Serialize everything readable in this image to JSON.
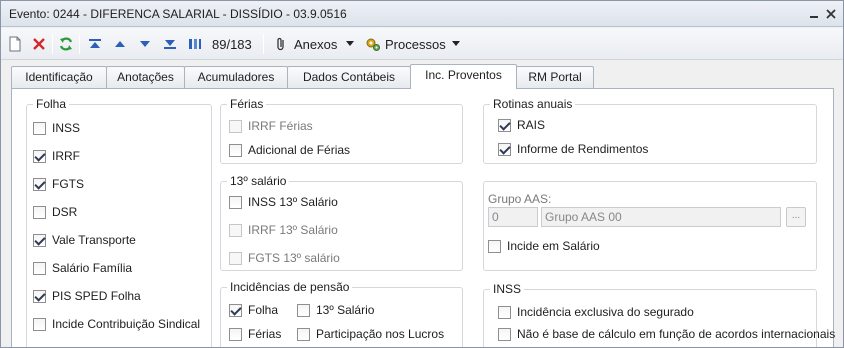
{
  "window": {
    "title": "Evento: 0244 - DIFERENCA SALARIAL - DISSÍDIO - 03.9.0516"
  },
  "toolbar": {
    "record_position": "89/183",
    "anexos_label": "Anexos",
    "processos_label": "Processos"
  },
  "tabs": [
    {
      "label": "Identificação"
    },
    {
      "label": "Anotações"
    },
    {
      "label": "Acumuladores"
    },
    {
      "label": "Dados Contábeis"
    },
    {
      "label": "Inc. Proventos"
    },
    {
      "label": "RM Portal"
    }
  ],
  "active_tab": "Inc. Proventos",
  "folha": {
    "title": "Folha",
    "items": [
      {
        "label": "INSS",
        "checked": false
      },
      {
        "label": "IRRF",
        "checked": true
      },
      {
        "label": "FGTS",
        "checked": true
      },
      {
        "label": "DSR",
        "checked": false
      },
      {
        "label": "Vale Transporte",
        "checked": true
      },
      {
        "label": "Salário Família",
        "checked": false
      },
      {
        "label": "PIS SPED Folha",
        "checked": true
      },
      {
        "label": "Incide Contribuição Sindical",
        "checked": false
      }
    ]
  },
  "ferias": {
    "title": "Férias",
    "items": [
      {
        "label": "IRRF Férias",
        "checked": false,
        "disabled": true
      },
      {
        "label": "Adicional de Férias",
        "checked": false,
        "disabled": false
      }
    ]
  },
  "decimo": {
    "title": "13º salário",
    "items": [
      {
        "label": "INSS 13º Salário",
        "checked": false,
        "disabled": false
      },
      {
        "label": "IRRF 13º Salário",
        "checked": false,
        "disabled": true
      },
      {
        "label": "FGTS 13º salário",
        "checked": false,
        "disabled": true
      }
    ]
  },
  "pensao": {
    "title": "Incidências de pensão",
    "folha": {
      "label": "Folha",
      "checked": true
    },
    "decimo": {
      "label": "13º Salário",
      "checked": false
    },
    "ferias": {
      "label": "Férias",
      "checked": false
    },
    "lucros": {
      "label": "Participação nos Lucros",
      "checked": false
    }
  },
  "rotinas": {
    "title": "Rotinas anuais",
    "items": [
      {
        "label": "RAIS",
        "checked": true
      },
      {
        "label": "Informe de Rendimentos",
        "checked": true
      }
    ]
  },
  "aas": {
    "label": "Grupo AAS:",
    "code": "0",
    "name": "Grupo AAS 00",
    "lookup": "...",
    "incide": {
      "label": "Incide em Salário",
      "checked": false
    }
  },
  "inss": {
    "title": "INSS",
    "items": [
      {
        "label": "Incidência exclusiva do segurado",
        "checked": false
      },
      {
        "label": "Não é base de cálculo em função de acordos internacionais",
        "checked": false
      }
    ]
  },
  "colors": {
    "accent_blue": "#2b5fb8",
    "delete_red": "#d22a2a",
    "refresh_green": "#2a9a3a"
  },
  "icons": [
    "new-document-icon",
    "delete-icon",
    "refresh-icon",
    "first-record-icon",
    "previous-record-icon",
    "next-record-icon",
    "last-record-icon",
    "attachment-icon",
    "processes-icon",
    "minimize-icon",
    "close-icon"
  ]
}
